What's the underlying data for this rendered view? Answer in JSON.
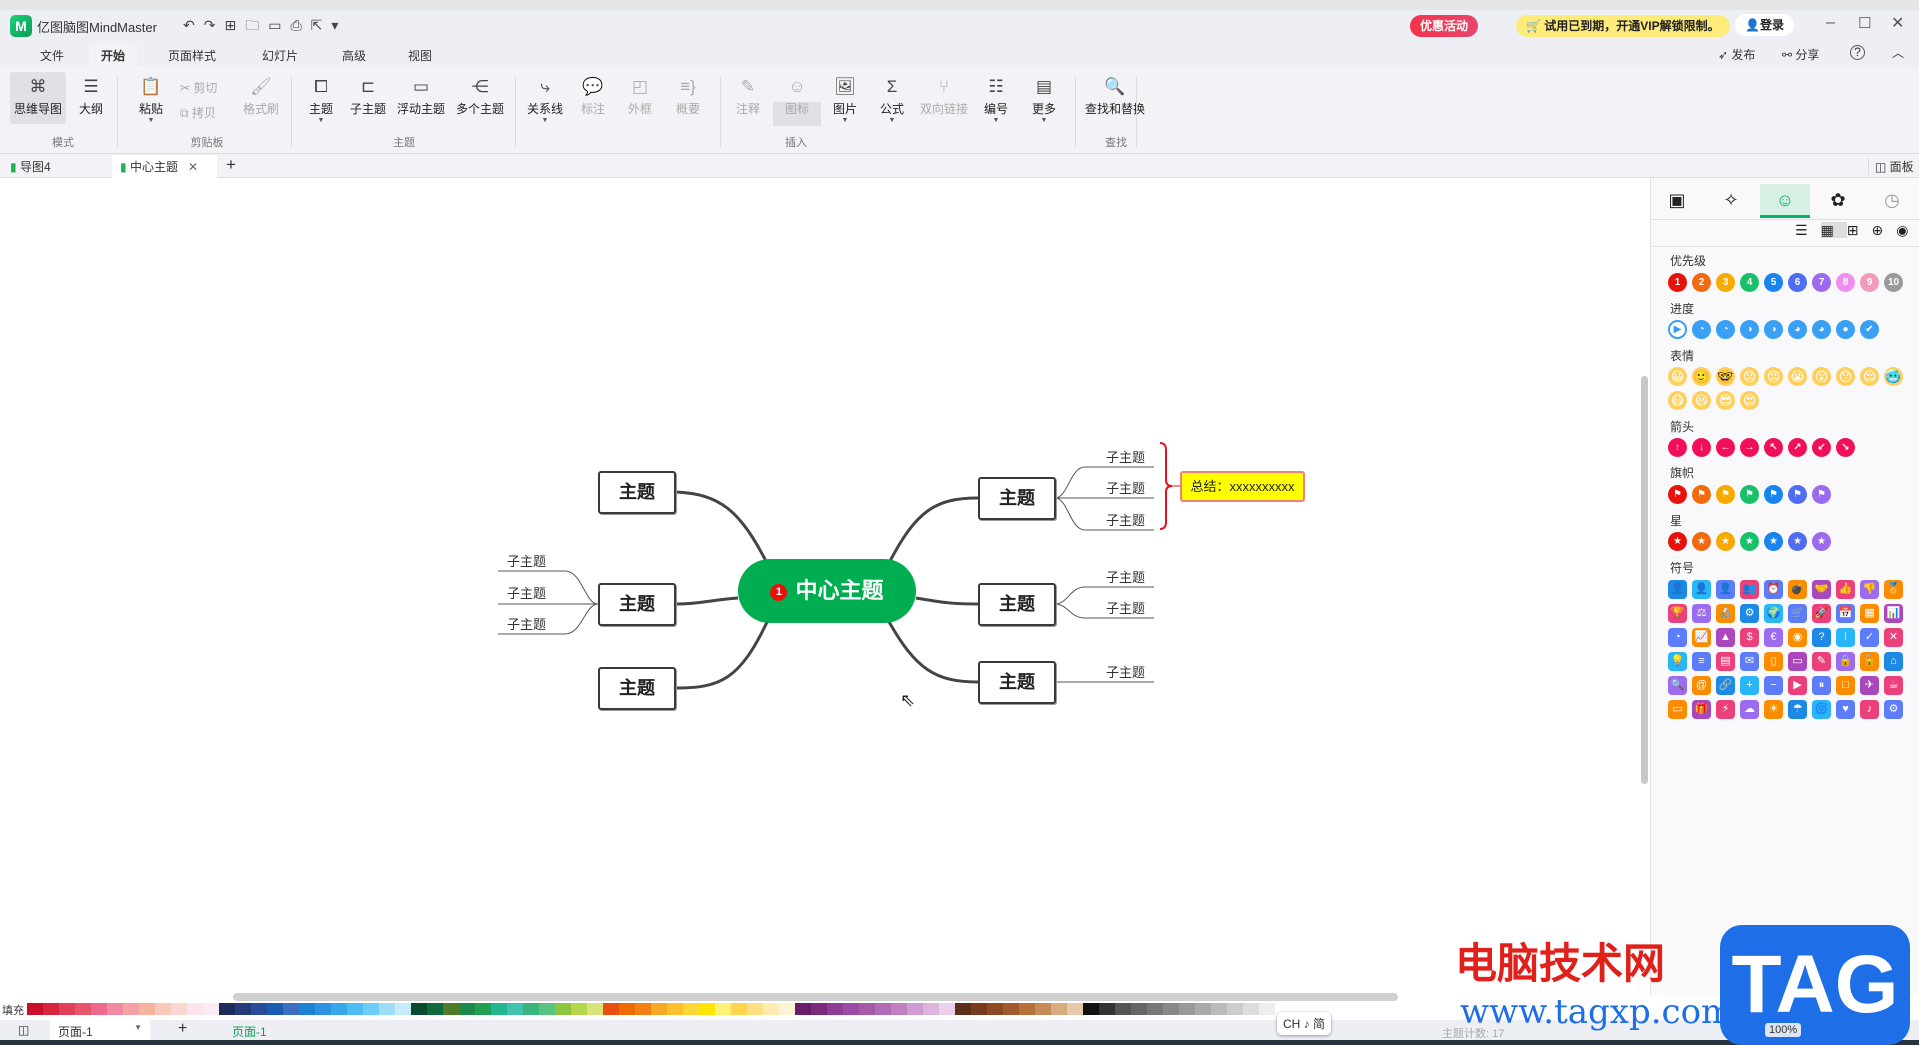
{
  "app": {
    "title": "亿图脑图MindMaster",
    "logo": "M"
  },
  "titlebar": {
    "promo": "优惠活动",
    "vip": "试用已到期，开通VIP解锁限制。",
    "login": "登录",
    "publish": "发布",
    "share": "分享",
    "help": "?"
  },
  "menu": [
    "文件",
    "开始",
    "页面样式",
    "幻灯片",
    "高级",
    "视图"
  ],
  "ribbon": {
    "buttons": {
      "mindmap": "思维导图",
      "outline": "大纲",
      "paste": "粘贴",
      "cut": "剪切",
      "copy": "拷贝",
      "format_painter": "格式刷",
      "topic": "主题",
      "subtopic": "子主题",
      "floating": "浮动主题",
      "multiple": "多个主题",
      "relation": "关系线",
      "callout": "标注",
      "boundary": "外框",
      "summary": "概要",
      "note": "注释",
      "icon": "图标",
      "image": "图片",
      "formula": "公式",
      "bilink": "双向链接",
      "numbering": "编号",
      "more": "更多",
      "find_replace": "查找和替换"
    },
    "groups": {
      "mode": "模式",
      "clipboard": "剪贴板",
      "topic": "主题",
      "insert": "插入",
      "find": "查找"
    }
  },
  "doc_tabs": [
    {
      "label": "导图4"
    },
    {
      "label": "中心主题"
    }
  ],
  "panel_toggle": "面板",
  "mindmap": {
    "central": "中心主题",
    "central_badge": "1",
    "left_topics": [
      "主题",
      "主题",
      "主题"
    ],
    "right_topics": [
      "主题",
      "主题",
      "主题"
    ],
    "left_subtopics": [
      "子主题",
      "子主题",
      "子主题"
    ],
    "right_subtopics_1": [
      "子主题",
      "子主题",
      "子主题"
    ],
    "right_subtopics_2": [
      "子主题",
      "子主题"
    ],
    "right_subtopics_3": [
      "子主题"
    ],
    "summary": "总结：xxxxxxxxxx"
  },
  "icon_panel": {
    "sections": {
      "priority": "优先级",
      "progress": "进度",
      "emotion": "表情",
      "arrow": "箭头",
      "flag": "旗帜",
      "star": "星",
      "symbol": "符号"
    },
    "priority": [
      "1",
      "2",
      "3",
      "4",
      "5",
      "6",
      "7",
      "8",
      "9",
      "10"
    ],
    "priority_colors": [
      "#e8120c",
      "#f26a10",
      "#f7a900",
      "#18c06a",
      "#1784f0",
      "#4f6df0",
      "#9b6af0",
      "#ee8ef0",
      "#f29ab8",
      "#9a9a9a"
    ],
    "progress_glyphs": [
      "▶",
      "◔",
      "◔",
      "◑",
      "◑",
      "◕",
      "◕",
      "●",
      "✔"
    ],
    "emotion_glyphs": [
      "😀",
      "🙂",
      "🤓",
      "😟",
      "😡",
      "😭",
      "😲",
      "😯",
      "😌",
      "🥶",
      "😷",
      "😆",
      "😎",
      "😍"
    ],
    "arrow_glyphs": [
      "↑",
      "↓",
      "←",
      "→",
      "↖",
      "↗",
      "↙",
      "↘"
    ],
    "flag_colors": [
      "#e8120c",
      "#f26a10",
      "#f7a900",
      "#18c06a",
      "#1784f0",
      "#4f6df0",
      "#9b6af0"
    ],
    "symbol_glyphs": [
      "👤",
      "👤",
      "👤",
      "👥",
      "⏰",
      "💣",
      "🤝",
      "👍",
      "👎",
      "🏅",
      "🏆",
      "⚖",
      "🔬",
      "⚙",
      "🌍",
      "🛒",
      "🚀",
      "📅",
      "▦",
      "📊",
      "◔",
      "📈",
      "▲",
      "$",
      "€",
      "◉",
      "?",
      "!",
      "✓",
      "✕",
      "💡",
      "≡",
      "▤",
      "✉",
      "▯",
      "▭",
      "✎",
      "🔒",
      "🔓",
      "⌂",
      "🔍",
      "@",
      "🔗",
      "+",
      "−",
      "▶",
      "⏸",
      "□",
      "✈",
      "☕",
      "▭",
      "🎁",
      "⚡",
      "☁",
      "☀",
      "☂",
      "🌀",
      "♥",
      "♪",
      "⚙"
    ],
    "symbol_colors": [
      "#1e88e5",
      "#ec407a",
      "#5c7cfa",
      "#29b6f6",
      "#9c6cf0",
      "#fb8c00",
      "#5c7cfa",
      "#fb8c00",
      "#ab47bc",
      "#ec407a"
    ]
  },
  "palette": {
    "label": "填充",
    "colors": [
      "#c8102e",
      "#d7263d",
      "#e0405a",
      "#e6556b",
      "#ec6a8c",
      "#f08aa0",
      "#f4a0a6",
      "#f4b59e",
      "#f9c8b8",
      "#fbd7d2",
      "#fde4ec",
      "#fdebf3",
      "#1c2b5a",
      "#233b7a",
      "#2a4a9a",
      "#1b5cb3",
      "#3a6fc4",
      "#1d82d1",
      "#2a92de",
      "#39a8e8",
      "#4dbcf0",
      "#6ccdf5",
      "#9fdcf6",
      "#c7ebf9",
      "#0c4a2f",
      "#0d6b3e",
      "#4f7a28",
      "#1b8a4a",
      "#20a050",
      "#23b58d",
      "#3fc2b0",
      "#3ab57c",
      "#58c37e",
      "#8cc63f",
      "#b5d64c",
      "#d5e57c",
      "#e84e0f",
      "#ef6c00",
      "#f57f17",
      "#f9a825",
      "#fbc02d",
      "#fdd835",
      "#ffe600",
      "#fff176",
      "#ffd54f",
      "#ffe082",
      "#ffecb3",
      "#fff3d6",
      "#6a1b6a",
      "#7b2a7b",
      "#8e3c96",
      "#9c4aa8",
      "#a65aa6",
      "#b06bb4",
      "#c07fc0",
      "#d09bd0",
      "#dcb4dc",
      "#ead0ea",
      "#5d2e1a",
      "#7a3a1e",
      "#8d4a24",
      "#a05a2c",
      "#b5703c",
      "#c68a5a",
      "#d8aa80",
      "#e8c8a8",
      "#111111",
      "#333333",
      "#555555",
      "#666666",
      "#777777",
      "#888888",
      "#999999",
      "#aaaaaa",
      "#bbbbbb",
      "#cccccc",
      "#dddddd",
      "#eeeeee"
    ]
  },
  "status": {
    "page_select": "页面-1",
    "page_tab": "页面-1",
    "topic_count_label": "主题计数:",
    "topic_count": "17",
    "zoom": "100%",
    "ime": "CH ♪ 简"
  },
  "watermark": {
    "site_cn": "电脑技术网",
    "url": "www.tagxp.com",
    "logo": "TAG"
  },
  "colors": {
    "accent": "#00a84f",
    "central_bg": "#00ad50",
    "summary_bg": "#ffff00",
    "brace": "#e81123"
  }
}
